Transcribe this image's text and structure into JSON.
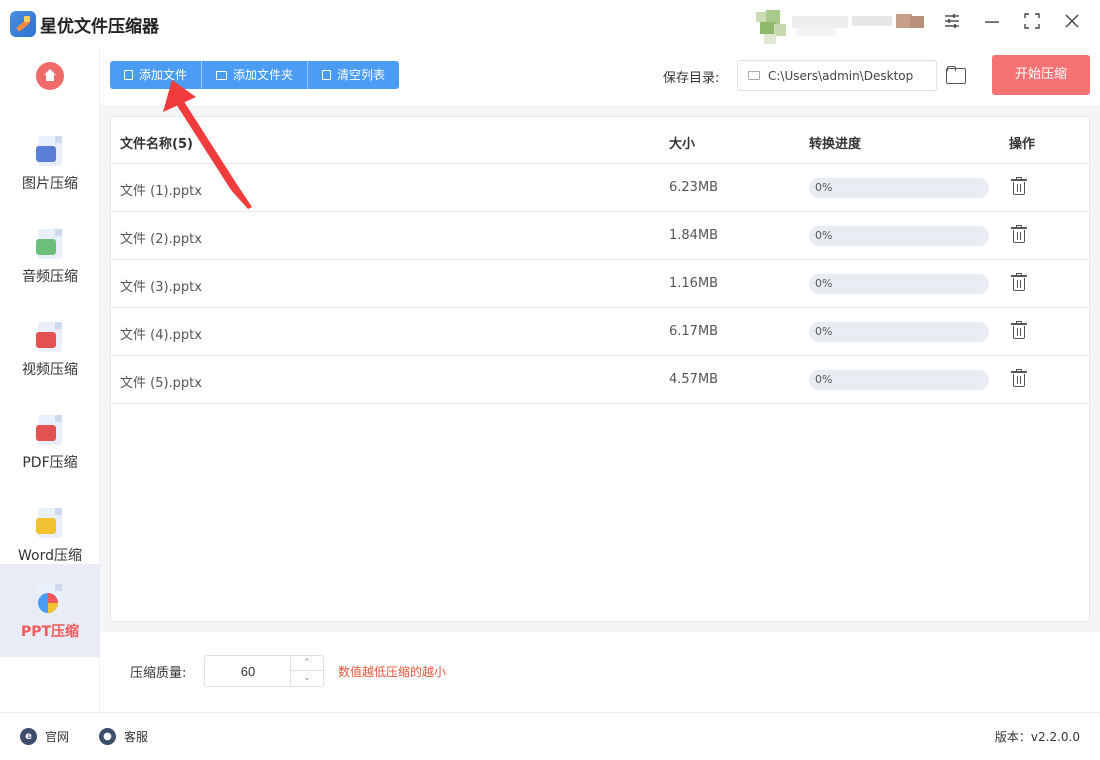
{
  "app": {
    "title": "星优文件压缩器"
  },
  "window_controls": {
    "settings_icon": "sliders-icon",
    "minimize_icon": "minimize-icon",
    "maximize_icon": "maximize-icon",
    "close_icon": "close-icon"
  },
  "sidebar": {
    "home_icon": "home-icon",
    "items": [
      {
        "label": "图片压缩",
        "icon": "image-icon",
        "color": "#5b7fd6",
        "active": false
      },
      {
        "label": "音频压缩",
        "icon": "music-icon",
        "color": "#6cc07a",
        "active": false
      },
      {
        "label": "视频压缩",
        "icon": "video-icon",
        "color": "#e25252",
        "active": false
      },
      {
        "label": "PDF压缩",
        "icon": "pdf-icon",
        "color": "#e25252",
        "active": false
      },
      {
        "label": "Word压缩",
        "icon": "word-icon",
        "color": "#f2c230",
        "active": false
      },
      {
        "label": "PPT压缩",
        "icon": "ppt-icon",
        "color": "#f15a5a",
        "active": true
      }
    ]
  },
  "toolbar": {
    "add_file": "添加文件",
    "add_folder": "添加文件夹",
    "clear_list": "清空列表",
    "save_dir_label": "保存目录:",
    "save_dir_path": "C:\\Users\\admin\\Desktop",
    "start_button": "开始压缩"
  },
  "table": {
    "headers": {
      "name": "文件名称(5)",
      "size": "大小",
      "progress": "转换进度",
      "action": "操作"
    },
    "rows": [
      {
        "name": "文件 (1).pptx",
        "size": "6.23MB",
        "progress_text": "0%",
        "progress": 0
      },
      {
        "name": "文件 (2).pptx",
        "size": "1.84MB",
        "progress_text": "0%",
        "progress": 0
      },
      {
        "name": "文件 (3).pptx",
        "size": "1.16MB",
        "progress_text": "0%",
        "progress": 0
      },
      {
        "name": "文件 (4).pptx",
        "size": "6.17MB",
        "progress_text": "0%",
        "progress": 0
      },
      {
        "name": "文件 (5).pptx",
        "size": "4.57MB",
        "progress_text": "0%",
        "progress": 0
      }
    ]
  },
  "quality": {
    "label": "压缩质量:",
    "value": "60",
    "hint": "数值越低压缩的越小"
  },
  "footer": {
    "website": "官网",
    "support": "客服",
    "version": "版本：v2.2.0.0"
  },
  "colors": {
    "primary": "#4a9cf5",
    "start": "#f47272",
    "active_nav": "#f15a5a",
    "hint": "#e2553a",
    "annotation_arrow": "#f03c3c"
  }
}
